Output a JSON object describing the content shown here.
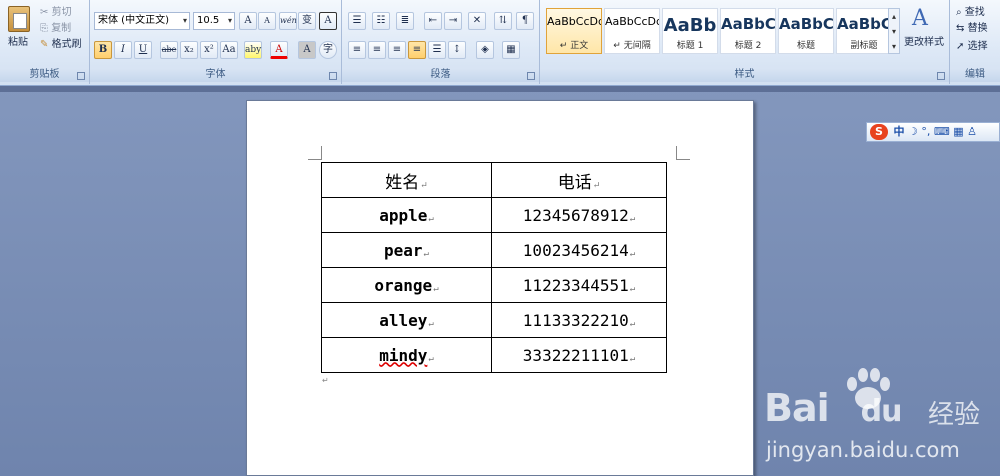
{
  "ribbon": {
    "clipboard": {
      "paste": "粘贴",
      "cut": "剪切",
      "copy": "复制",
      "format_painter": "格式刷",
      "group_label": "剪贴板"
    },
    "font": {
      "font_name": "宋体 (中文正文)",
      "font_size": "10.5",
      "glyph_wen": "wén",
      "glyph_char_border": "A",
      "group_label": "字体",
      "bold": "B",
      "italic": "I",
      "underline": "U",
      "strike": "abe",
      "sub": "x₂",
      "sup": "x²",
      "change_case": "Aa",
      "highlight": "aby",
      "color": "A",
      "char_shading": "A",
      "enclose": "字",
      "grow": "A",
      "shrink": "A",
      "phonetic": "变"
    },
    "paragraph": {
      "group_label": "段落"
    },
    "styles": {
      "group_label": "样式",
      "cards": [
        {
          "sample": "AaBbCcDd",
          "name": "↵ 正文",
          "size": "11px",
          "weight": "normal"
        },
        {
          "sample": "AaBbCcDd",
          "name": "↵ 无间隔",
          "size": "11px",
          "weight": "normal"
        },
        {
          "sample": "AaBb",
          "name": "标题 1",
          "size": "18px",
          "weight": "bold"
        },
        {
          "sample": "AaBbC",
          "name": "标题 2",
          "size": "15px",
          "weight": "bold"
        },
        {
          "sample": "AaBbC",
          "name": "标题",
          "size": "15px",
          "weight": "bold"
        },
        {
          "sample": "AaBbC",
          "name": "副标题",
          "size": "15px",
          "weight": "bold"
        }
      ],
      "change_styles": "更改样式"
    },
    "editing": {
      "find": "查找",
      "replace": "替换",
      "select": "选择",
      "group_label": "编辑"
    }
  },
  "ime": {
    "logo": "S",
    "lang": "中"
  },
  "table": {
    "header": [
      "姓名",
      "电话"
    ],
    "rows": [
      [
        "apple",
        "12345678912"
      ],
      [
        "pear",
        "10023456214"
      ],
      [
        "orange",
        "11223344551"
      ],
      [
        "alley",
        "11133322210"
      ],
      [
        "mindy",
        "33322211101"
      ]
    ],
    "mark": "↵"
  },
  "watermark": {
    "brand1": "Bai",
    "brand2": "du",
    "brand_cn": "经验",
    "url": "jingyan.baidu.com"
  }
}
